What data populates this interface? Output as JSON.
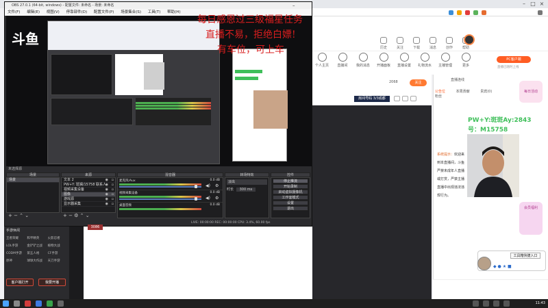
{
  "browser": {
    "close_glyph": "×",
    "min_glyph": "–",
    "max_glyph": "□"
  },
  "site": {
    "pc_client": "PC客户端",
    "pc_client_sub": "直播已随时上线",
    "header_items": [
      "历史",
      "关注",
      "下载",
      "消息",
      "创作",
      "帮助"
    ],
    "categories": [
      "个人主页",
      "直播间",
      "我的消息",
      "开播面板",
      "直播设置",
      "礼物流水",
      "主播管理",
      "更多"
    ]
  },
  "obs": {
    "title": "OBS 27.0.1 (64-bit, windows) - 配置文件: 未命名 - 场景: 未命名",
    "menu": [
      "文件(F)",
      "编辑(E)",
      "视图(V)",
      "停靠部件(D)",
      "配置文件(P)",
      "场景集合(S)",
      "工具(T)",
      "帮助(H)"
    ],
    "scene_label": "未选择源",
    "panels": {
      "scenes": "场景",
      "sources": "来源",
      "mixer": "混音器",
      "transitions": "转场特效",
      "controls": "控件"
    },
    "scene_item": "场景",
    "sources": [
      {
        "name": "文本 2",
        "selected": false
      },
      {
        "name": "PW+Y: 斑斓/15758 联系人",
        "selected": false
      },
      {
        "name": "视频采集设备",
        "selected": false
      },
      {
        "name": "图像",
        "selected": true
      },
      {
        "name": "游戏源",
        "selected": false
      },
      {
        "name": "显示器采集",
        "selected": false
      }
    ],
    "mixer": [
      {
        "name": "麦克风/Aux",
        "db": "0.0 dB"
      },
      {
        "name": "视频采集设备",
        "db": "0.0 dB"
      },
      {
        "name": "桌面音频",
        "db": "0.0 dB"
      }
    ],
    "transition": "淡出",
    "duration_label": "时长",
    "duration_value": "300 ms",
    "controls": [
      "停止推流",
      "开始录制",
      "启动虚拟摄像机",
      "工作室模式",
      "设置",
      "退出"
    ],
    "status": "LIVE: 00:00:00   REC: 00:00:00   CPU: 3.4%, 60.00 fps"
  },
  "douyu": {
    "logo": "斗鱼",
    "count_badge": "3086",
    "side_title": "手游休闲",
    "side_items": [
      "王者荣耀",
      "和平精英",
      "火影忍者",
      "LOL手游",
      "金铲铲之战",
      "植物大战",
      "CODM手游",
      "第五人格",
      "CF手游",
      "原神",
      "球球大作战",
      "天刀手游"
    ],
    "btn_client": "客户端打开",
    "btn_start": "我要开播",
    "follow_count": "2068",
    "follow_btn": "关注",
    "room_label": "房间号码 3/3成都",
    "chat_tabs": [
      "公告位",
      "本周贡献",
      "贵宾(0)",
      "粉丝"
    ],
    "chat_top_right": "直播连线",
    "notice_label": "系统提示：",
    "notice_text": "欢迎来到本直播间，斗鱼严禁未成年人直播或打赏，严禁主播直播中出现违法违规行为。",
    "pw_text": "PW+Y:斑斑Ay:2843",
    "phone_text": "号：M15758",
    "gift_label": "每日活动",
    "gift2_label": "会员福利",
    "mini_btn": "工具箱快捷入口"
  },
  "overlay": {
    "line1": "每日感恩过三级福星任务",
    "line2": "直播不易，拒绝白嫖!",
    "line3": "有车位，可上车"
  },
  "taskbar": {
    "clock": "11:43"
  }
}
